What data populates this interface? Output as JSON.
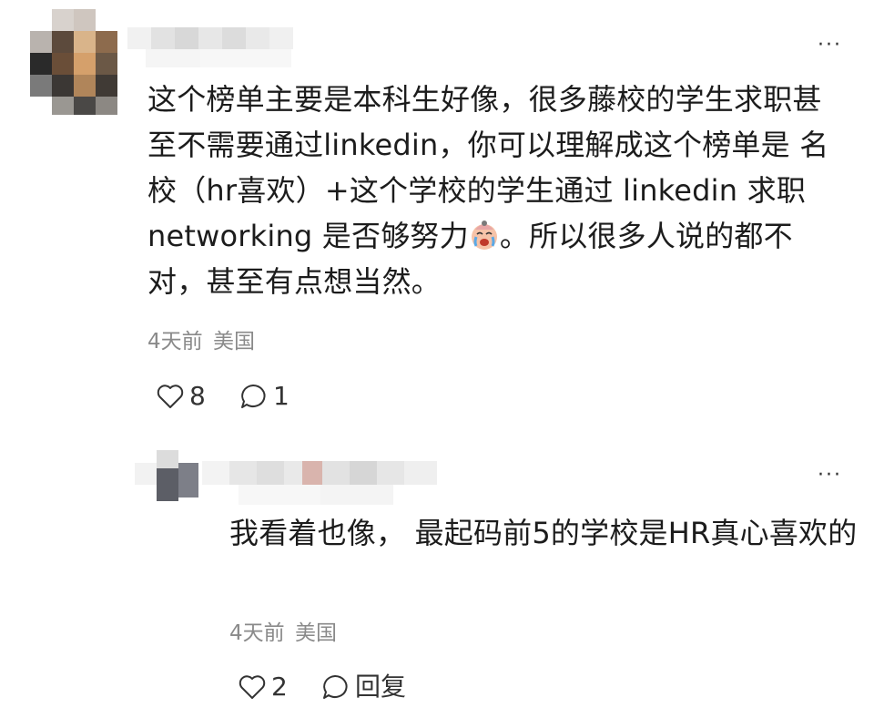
{
  "comment": {
    "more_label": "···",
    "text_before_emoji": "这个榜单主要是本科生好像，很多藤校的学生求职甚至不需要通过linkedin，你可以理解成这个榜单是 名校（hr喜欢）+这个学校的学生通过 linkedin 求职 networking 是否够努力",
    "emoji_icon": "crying-face-emoji",
    "text_after_emoji": "。所以很多人说的都不对，甚至有点想当然。",
    "time": "4天前",
    "location": "美国",
    "likes": "8",
    "replies": "1"
  },
  "reply": {
    "more_label": "···",
    "text": "我看着也像， 最起码前5的学校是HR真心喜欢的",
    "time": "4天前",
    "location": "美国",
    "likes": "2",
    "reply_label": "回复"
  },
  "colors": {
    "text": "#1c1c1c",
    "meta": "#8a8a8a",
    "background": "#ffffff"
  }
}
